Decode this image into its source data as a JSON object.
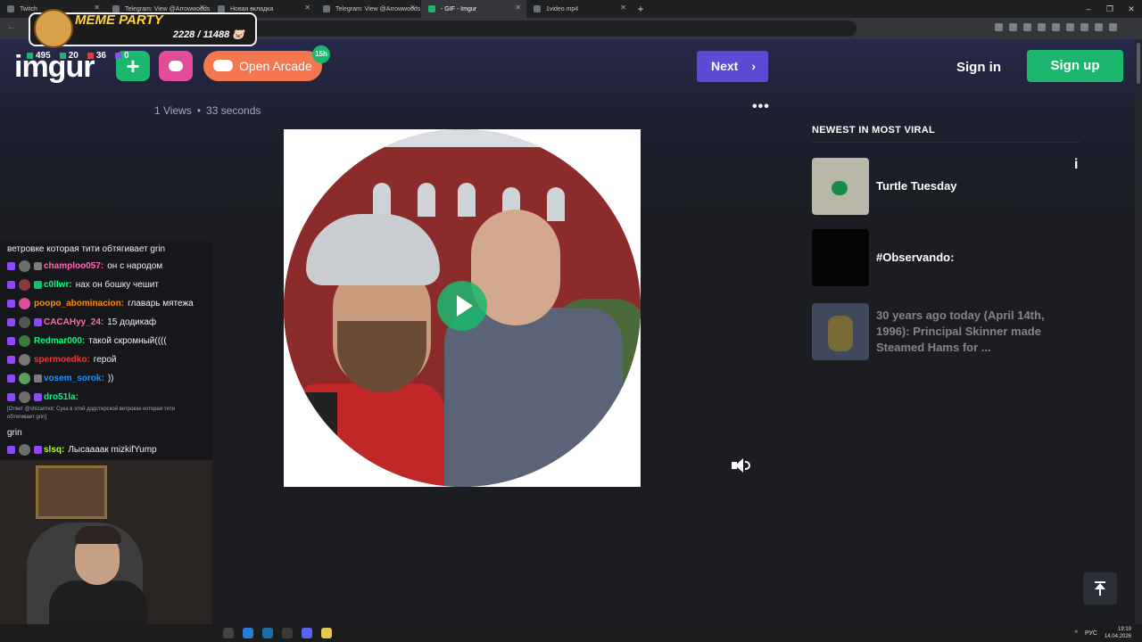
{
  "browser": {
    "tabs": [
      {
        "title": "Twitch",
        "active": false
      },
      {
        "title": "Telegram: View @Arrowwoods",
        "active": false
      },
      {
        "title": "Новая вкладка",
        "active": false
      },
      {
        "title": "Telegram: View @Arrowwoods",
        "active": false
      },
      {
        "title": "- GIF - Imgur",
        "active": true
      },
      {
        "title": "1video.mp4",
        "active": false
      }
    ],
    "new_tab": "+",
    "window_controls": [
      "–",
      "❐",
      "✕"
    ]
  },
  "imgur": {
    "logo": "imgur",
    "arcade_label": "Open Arcade",
    "arcade_badge": "15h",
    "next_label": "Next",
    "signin_label": "Sign in",
    "signup_label": "Sign up",
    "views": "1 Views",
    "meta_sep": "•",
    "duration": "33 seconds",
    "more_icon": "•••",
    "sidebar_title": "NEWEST IN MOST VIRAL",
    "viral_posts": [
      {
        "title": "Turtle Tuesday"
      },
      {
        "title": "#Observando:"
      },
      {
        "title": "30 years ago today (April 14th, 1996): Principal Skinner made Steamed Hams for ..."
      }
    ],
    "info_glyph": "i",
    "colors": {
      "accent_green": "#1bb76e",
      "next_purple": "#5b4bd4",
      "arcade_orange": "#f4774f",
      "fun_pink": "#e34d98"
    }
  },
  "overlay": {
    "meme_title": "MEME PARTY",
    "meme_count": "2228 / 11488 🐷",
    "stats": [
      "495",
      "20",
      "36",
      "0"
    ]
  },
  "chat": {
    "first_line": "ветровке которая тити обтягивает grin",
    "messages": [
      {
        "nick": "champloo057:",
        "text": "он с народом",
        "color": "#ff69b4"
      },
      {
        "nick": "c0llwr:",
        "text": "нах он бошку чешит",
        "color": "#00ff7f"
      },
      {
        "nick": "poopo_abominacion:",
        "text": "главарь мятежа",
        "color": "#ff8c00"
      },
      {
        "nick": "CACAHyy_24:",
        "text": "15 додикаф",
        "color": "#ff69b4"
      },
      {
        "nick": "Redmar000:",
        "text": "такой скромный((((",
        "color": "#00ff7f"
      },
      {
        "nick": "spermoedko:",
        "text": "герой",
        "color": "#ff3030"
      },
      {
        "nick": "vosem_sorok:",
        "text": "))",
        "color": "#1e90ff"
      },
      {
        "nick": "dro51la:",
        "text": "",
        "color": "#00ff7f"
      }
    ],
    "reply_note": "[Ответ @shizarmot: Сука в этой додстерской ветровке которая тити обтягивает grin]",
    "reply_text": "grin",
    "last_msg": {
      "nick": "slsq:",
      "text": "Лысаааак mizkifYump",
      "color": "#adff2f"
    }
  },
  "taskbar": {
    "lang": "РУС",
    "time": "19:19",
    "date": "14.04.2026"
  }
}
